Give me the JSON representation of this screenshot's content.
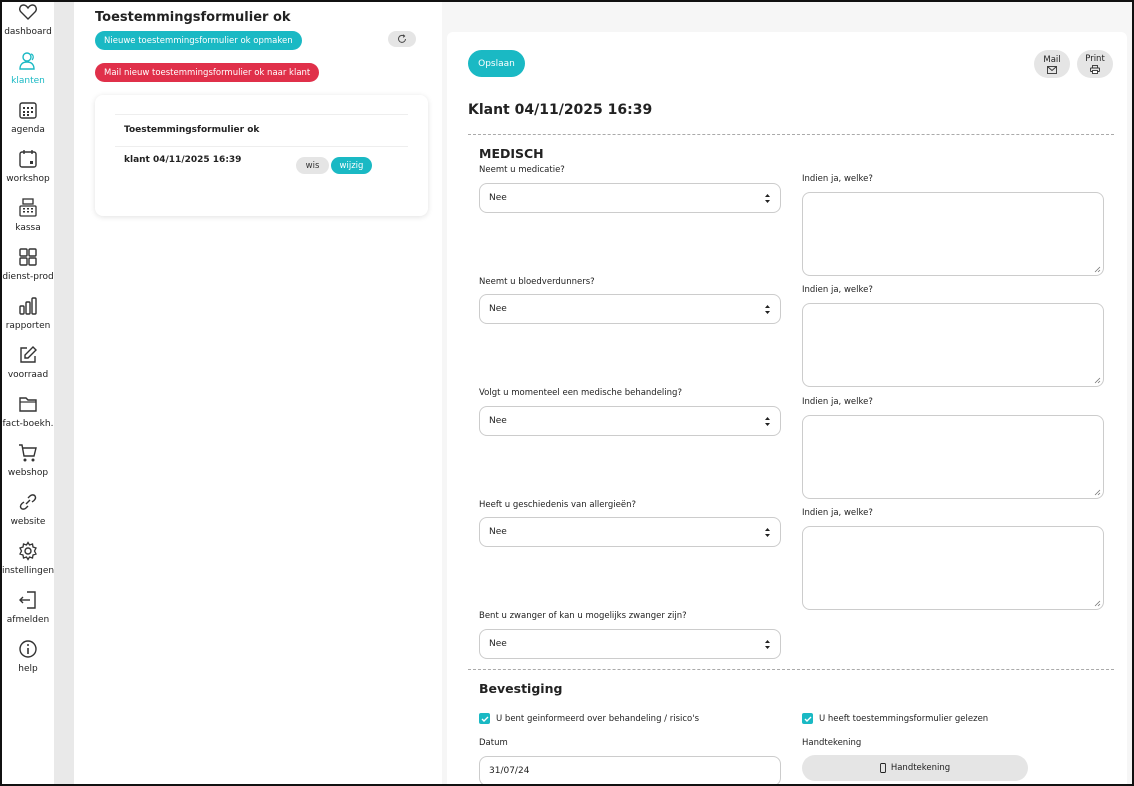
{
  "sidebar": {
    "items": [
      {
        "label": "dashboard",
        "icon": "heart-icon"
      },
      {
        "label": "klanten",
        "icon": "users-icon",
        "active": true
      },
      {
        "label": "agenda",
        "icon": "calendar-icon"
      },
      {
        "label": "workshop",
        "icon": "calendar-small-icon"
      },
      {
        "label": "kassa",
        "icon": "cash-register-icon"
      },
      {
        "label": "dienst-prod",
        "icon": "grid-icon"
      },
      {
        "label": "rapporten",
        "icon": "bar-chart-icon"
      },
      {
        "label": "voorraad",
        "icon": "edit-icon"
      },
      {
        "label": "fact-boekh.",
        "icon": "folder-icon"
      },
      {
        "label": "webshop",
        "icon": "cart-icon"
      },
      {
        "label": "website",
        "icon": "link-icon"
      },
      {
        "label": "instellingen",
        "icon": "gear-icon"
      },
      {
        "label": "afmelden",
        "icon": "logout-icon"
      },
      {
        "label": "help",
        "icon": "info-icon"
      }
    ]
  },
  "left": {
    "title": "Toestemmingsformulier ok",
    "new_button": "Nieuwe toestemmingsformulier ok opmaken",
    "mail_button": "Mail nieuw toestemmingsformulier ok naar klant",
    "card": {
      "heading": "Toestemmingsformulier ok",
      "row_label": "klant 04/11/2025 16:39",
      "delete_label": "wis",
      "edit_label": "wijzig"
    }
  },
  "right": {
    "save_label": "Opslaan",
    "mail_label": "Mail",
    "print_label": "Print",
    "title": "Klant 04/11/2025 16:39",
    "medical_title": "MEDISCH",
    "which_label": "Indien ja, welke?",
    "questions": [
      {
        "label": "Neemt u medicatie?",
        "value": "Nee"
      },
      {
        "label": "Neemt u bloedverdunners?",
        "value": "Nee"
      },
      {
        "label": "Volgt u momenteel een medische behandeling?",
        "value": "Nee"
      },
      {
        "label": "Heeft u geschiedenis van allergieën?",
        "value": "Nee"
      },
      {
        "label": "Bent u zwanger of kan u mogelijks zwanger zijn?",
        "value": "Nee"
      }
    ],
    "confirm_title": "Bevestiging",
    "check_informed": "U bent geinformeerd over behandeling / risico's",
    "check_read": "U heeft toestemmingsformulier gelezen",
    "date_label": "Datum",
    "date_value": "31/07/24",
    "signature_label": "Handtekening",
    "signature_button": "Handtekening"
  },
  "colors": {
    "accent": "#1ab9c4",
    "danger": "#e0304a"
  }
}
